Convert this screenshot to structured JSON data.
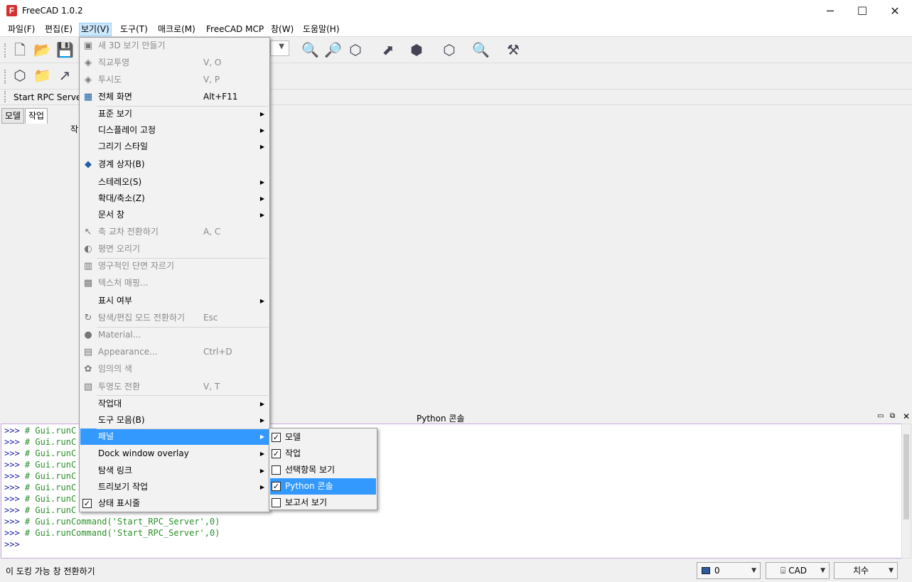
{
  "window": {
    "app_name": "FreeCAD 1.0.2",
    "logo_letter": "F",
    "minimize": "─",
    "maximize": "☐",
    "close": "✕"
  },
  "menubar": {
    "items": [
      "파일(F)",
      "편집(E)",
      "보기(V)",
      "도구(T)",
      "매크로(M)",
      "FreeCAD MCP",
      "창(W)",
      "도움말(H)"
    ],
    "active": "보기(V)"
  },
  "toolbars": {
    "rpc_label": "Start RPC Server"
  },
  "tabs": [
    "모델",
    "작업"
  ],
  "task_header": "작",
  "view_menu": {
    "items": [
      {
        "label": "새 3D 보기 만들기",
        "shortcut": "",
        "disabled": true,
        "icon": "new-view-icon"
      },
      {
        "label": "직교투영",
        "shortcut": "V, O",
        "disabled": true,
        "icon": "ortho-cube-icon"
      },
      {
        "label": "투시도",
        "shortcut": "V, P",
        "disabled": true,
        "icon": "perspective-cube-icon"
      },
      {
        "label": "전체 화면",
        "shortcut": "Alt+F11",
        "disabled": false,
        "icon": "fullscreen-icon"
      },
      {
        "label": "표준 보기",
        "submenu": true
      },
      {
        "label": "디스플레이 고정",
        "submenu": true
      },
      {
        "label": "그리기 스타일",
        "submenu": true
      },
      {
        "label": "경계 상자(B)",
        "disabled": false,
        "icon": "bounding-box-icon"
      },
      {
        "label": "스테레오(S)",
        "submenu": true
      },
      {
        "label": "확대/축소(Z)",
        "submenu": true
      },
      {
        "label": "문서 창",
        "submenu": true
      },
      {
        "label": "축 교차 전환하기",
        "shortcut": "A, C",
        "disabled": true,
        "icon": "axis-cross-icon"
      },
      {
        "label": "평면 오리기",
        "disabled": true,
        "icon": "clipping-plane-icon"
      },
      {
        "label": "영구적인 단면 자르기",
        "disabled": true,
        "icon": "section-cut-icon"
      },
      {
        "label": "텍스처 매핑...",
        "disabled": true,
        "icon": "texture-icon"
      },
      {
        "label": "표시 여부",
        "submenu": true
      },
      {
        "label": "탐색/편집 모드 전환하기",
        "shortcut": "Esc",
        "disabled": true,
        "icon": "toggle-mode-icon"
      },
      {
        "label": "Material...",
        "disabled": true,
        "icon": "material-icon"
      },
      {
        "label": "Appearance...",
        "shortcut": "Ctrl+D",
        "disabled": true,
        "icon": "appearance-icon"
      },
      {
        "label": "임의의 색",
        "disabled": true,
        "icon": "random-color-icon"
      },
      {
        "label": "투명도 전환",
        "shortcut": "V, T",
        "disabled": true,
        "icon": "transparency-icon"
      },
      {
        "label": "작업대",
        "submenu": true
      },
      {
        "label": "도구 모음(B)",
        "submenu": true
      },
      {
        "label": "패널",
        "submenu": true,
        "highlighted": true
      },
      {
        "label": "Dock window overlay",
        "submenu": true
      },
      {
        "label": "탐색 링크",
        "submenu": true
      },
      {
        "label": "트리보기 작업",
        "submenu": true
      },
      {
        "label": "상태 표시줄",
        "checked": true
      }
    ]
  },
  "panel_submenu": {
    "items": [
      {
        "label": "모델",
        "checked": true
      },
      {
        "label": "작업",
        "checked": true
      },
      {
        "label": "선택항목 보기",
        "checked": false
      },
      {
        "label": "Python 콘솔",
        "checked": true,
        "highlighted": true
      },
      {
        "label": "보고서 보기",
        "checked": false
      }
    ]
  },
  "console": {
    "title": "Python 콘솔",
    "prompt": ">>>",
    "hidden_lines": [
      "# Gui.runC",
      "# Gui.runC",
      "# Gui.runC",
      "# Gui.runC",
      "# Gui.runC",
      "# Gui.runC",
      "# Gui.runC",
      "# Gui.runC"
    ],
    "full_lines": [
      "# Gui.runCommand('Start_RPC_Server',0)",
      "# Gui.runCommand('Start_RPC_Server',0)"
    ]
  },
  "statusbar": {
    "text": "이 도킹 가능 창 전환하기",
    "box1": "0",
    "box2": "CAD",
    "box3": "치수"
  },
  "colors": {
    "highlight": "#3399ff",
    "console_prompt": "#1a1aa8",
    "console_comment": "#2a8f2a"
  }
}
